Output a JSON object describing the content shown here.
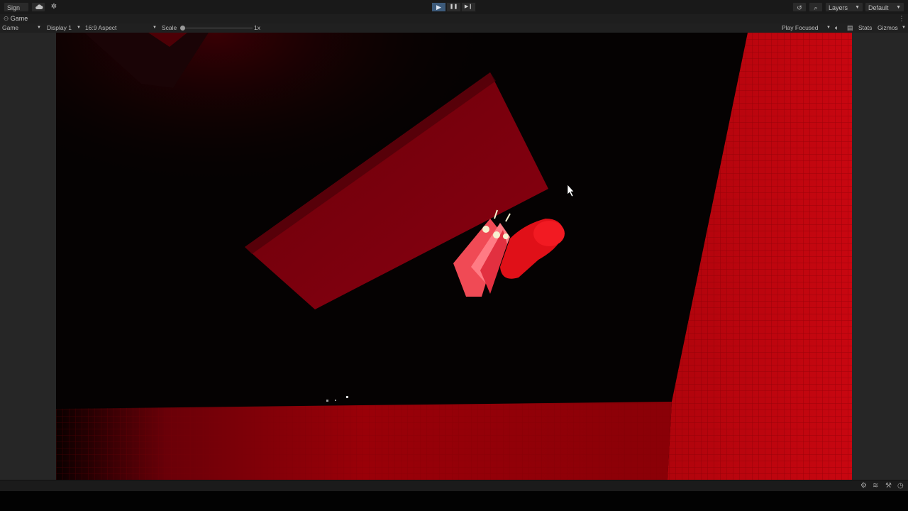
{
  "toolbar": {
    "sign_in_label": "Sign in",
    "cloud_icon": "cloud-icon",
    "services_icon": "services-icon",
    "play_icon": "▶",
    "pause_icon": "❚❚",
    "step_icon": "▶❙",
    "history_icon": "↺",
    "search_icon": "⌕",
    "layers_label": "Layers",
    "layout_label": "Default"
  },
  "tab": {
    "label": "Game"
  },
  "gamebar": {
    "mode_label": "Game",
    "display_label": "Display 1",
    "aspect_label": "16:9 Aspect",
    "scale_label": "Scale",
    "scale_value": "1x",
    "play_focused_label": "Play Focused",
    "stats_label": "Stats",
    "gizmos_label": "Gizmos",
    "scale_fraction": 0.0
  },
  "colors": {
    "accent": "#3c5a7a",
    "scene_red": "#c0040a",
    "background": "#050202"
  }
}
